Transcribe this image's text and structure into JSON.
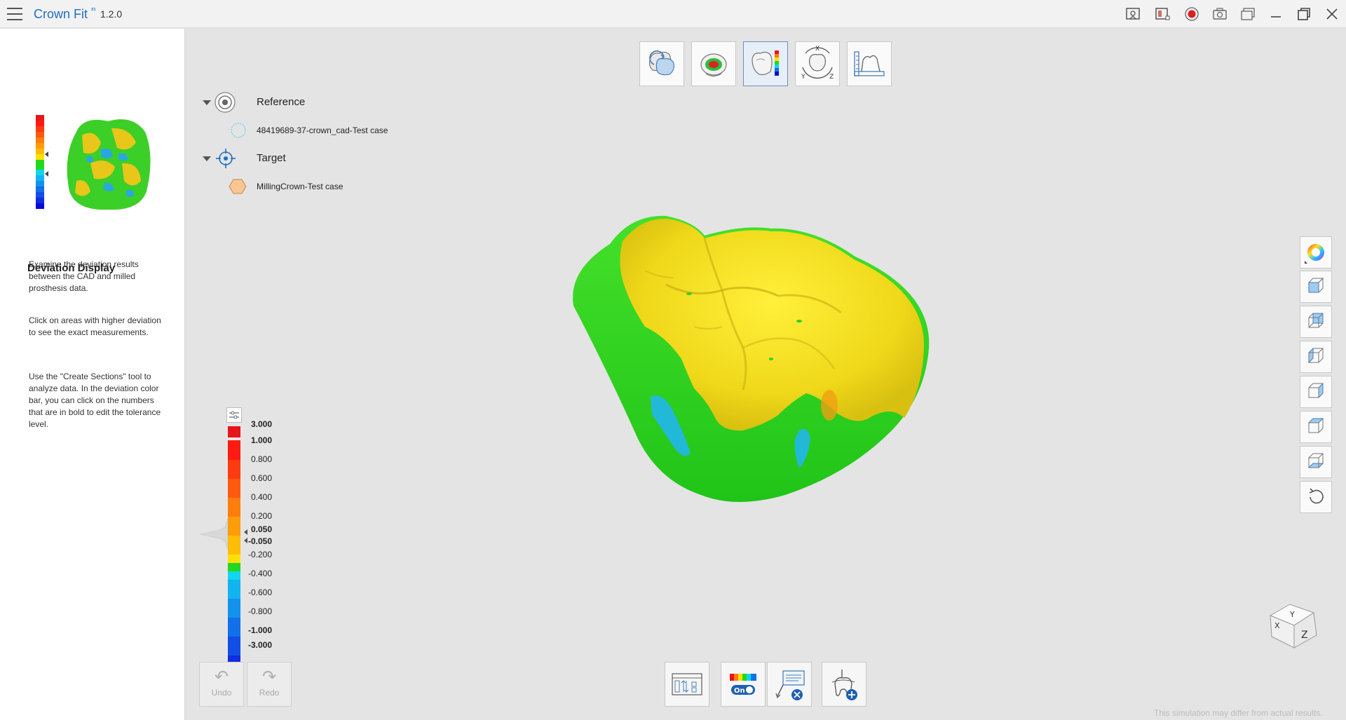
{
  "app": {
    "name": "Crown Fit",
    "badge": "²¹",
    "version": "1.2.0"
  },
  "titlebar": {
    "icons": [
      "capture-icon",
      "layout-icon",
      "record-icon",
      "camera-icon",
      "gallery-icon",
      "minimize-icon",
      "maximize-icon",
      "close-icon"
    ],
    "record_color": "#e02020"
  },
  "left_panel": {
    "title": "Deviation Display",
    "paragraphs": [
      "Examine the deviation results between the CAD and milled prosthesis data.",
      "Click on areas with higher deviation to see the exact measurements.",
      "Use the \"Create Sections\" tool to analyze data. In the deviation color bar, you can click on the numbers that are in bold to edit the tolerance level."
    ]
  },
  "top_tools": [
    "align-tool",
    "fit-tool",
    "deviation-display-tool",
    "axis-tool",
    "measure-tool"
  ],
  "tree": {
    "reference_label": "Reference",
    "reference_item": "48419689-37-crown_cad-Test case",
    "target_label": "Target",
    "target_item": "MillingCrown-Test case"
  },
  "color_scale": {
    "segments": [
      {
        "color": "#e8141c"
      },
      {
        "color": "#ff1a12"
      },
      {
        "color": "#ff3b10"
      },
      {
        "color": "#ff5a0e"
      },
      {
        "color": "#ff7d0c"
      },
      {
        "color": "#ff9c0a"
      },
      {
        "color": "#ffbd08"
      },
      {
        "color": "#ffe006"
      },
      {
        "color": "#22d81e"
      },
      {
        "color": "#12d6f0"
      },
      {
        "color": "#12b4f0"
      },
      {
        "color": "#1292ee"
      },
      {
        "color": "#1270ea"
      },
      {
        "color": "#124ee6"
      },
      {
        "color": "#122ce2"
      },
      {
        "color": "#0a0ad8"
      }
    ],
    "labels": [
      {
        "text": "3.000",
        "bold": true
      },
      {
        "text": "1.000",
        "bold": true
      },
      {
        "text": "0.800",
        "bold": false
      },
      {
        "text": "0.600",
        "bold": false
      },
      {
        "text": "0.400",
        "bold": false
      },
      {
        "text": "0.200",
        "bold": false
      },
      {
        "text": "0.050",
        "bold": true
      },
      {
        "text": "-0.050",
        "bold": true
      },
      {
        "text": "-0.200",
        "bold": false
      },
      {
        "text": "-0.400",
        "bold": false
      },
      {
        "text": "-0.600",
        "bold": false
      },
      {
        "text": "-0.800",
        "bold": false
      },
      {
        "text": "-1.000",
        "bold": true
      },
      {
        "text": "-3.000",
        "bold": true
      }
    ]
  },
  "right_tools": [
    "color-wheel-icon",
    "view-front-icon",
    "view-back-icon",
    "view-left-icon",
    "view-right-icon",
    "view-top-icon",
    "view-bottom-icon",
    "reset-view-icon"
  ],
  "bottom": {
    "undo_label": "Undo",
    "redo_label": "Redo",
    "tools": [
      "section-tool",
      "colorbar-toggle",
      "clear-points-tool",
      "add-tooth-tool"
    ],
    "toggle_label": "On",
    "disclaimer": "This simulation may differ from actual results."
  },
  "navcube": {
    "labels": [
      "Y",
      "X",
      "Z"
    ]
  }
}
